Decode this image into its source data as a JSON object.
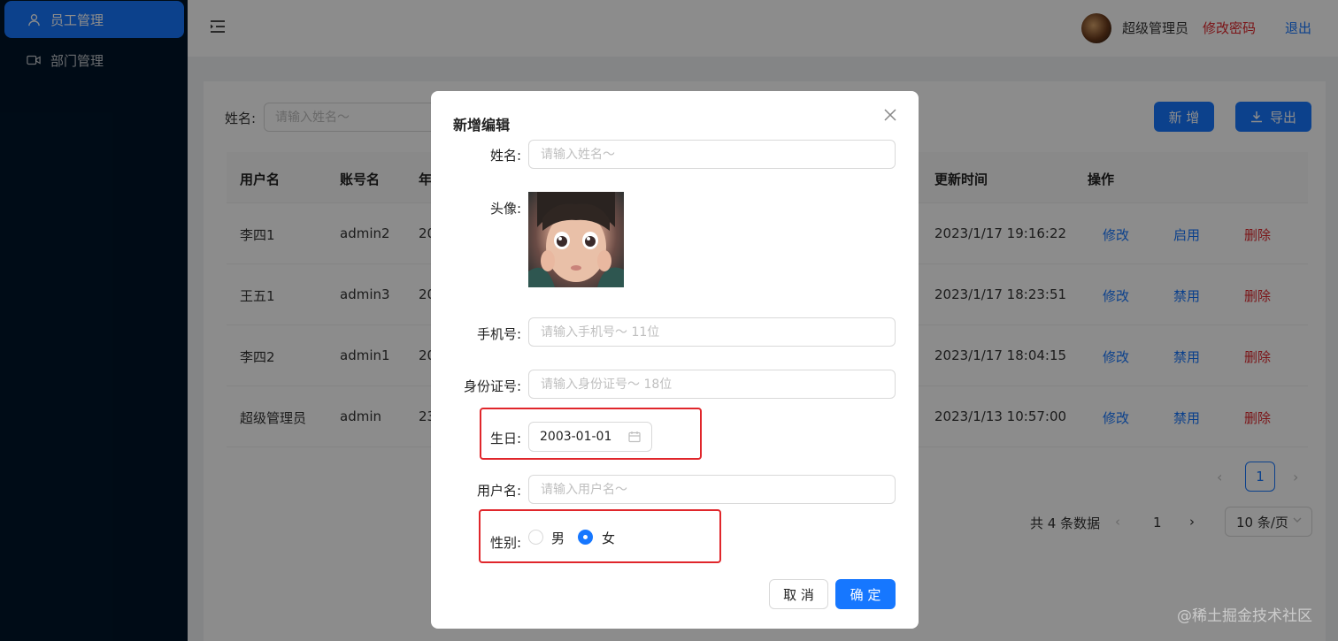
{
  "sidebar": {
    "items": [
      {
        "label": "员工管理",
        "icon": "user-icon",
        "active": true
      },
      {
        "label": "部门管理",
        "icon": "video-icon",
        "active": false
      }
    ]
  },
  "header": {
    "admin_name": "超级管理员",
    "change_password": "修改密码",
    "logout": "退出"
  },
  "search": {
    "label": "姓名:",
    "placeholder": "请输入姓名～"
  },
  "toolbar": {
    "add_label": "新 增",
    "export_label": "导出"
  },
  "table": {
    "headers": [
      "用户名",
      "账号名",
      "年",
      "更新时间",
      "操作"
    ],
    "rows": [
      {
        "name": "李四1",
        "account": "admin2",
        "year": "20",
        "updated": "2023/1/17 19:16:22",
        "edit": "修改",
        "toggle": "启用",
        "delete": "删除"
      },
      {
        "name": "王五1",
        "account": "admin3",
        "year": "20",
        "updated": "2023/1/17 18:23:51",
        "edit": "修改",
        "toggle": "禁用",
        "delete": "删除"
      },
      {
        "name": "李四2",
        "account": "admin1",
        "year": "20",
        "updated": "2023/1/17 18:04:15",
        "edit": "修改",
        "toggle": "禁用",
        "delete": "删除"
      },
      {
        "name": "超级管理员",
        "account": "admin",
        "year": "23",
        "updated": "2023/1/13 10:57:00",
        "edit": "修改",
        "toggle": "禁用",
        "delete": "删除"
      }
    ]
  },
  "pagination": {
    "current_page": "1",
    "total_text": "共 4 条数据",
    "page_number": "1",
    "page_size": "10 条/页"
  },
  "modal": {
    "title": "新增编辑",
    "fields": {
      "name_label": "姓名:",
      "name_placeholder": "请输入姓名～",
      "avatar_label": "头像:",
      "phone_label": "手机号:",
      "phone_placeholder": "请输入手机号～ 11位",
      "id_label": "身份证号:",
      "id_placeholder": "请输入身份证号～ 18位",
      "birthday_label": "生日:",
      "birthday_value": "2003-01-01",
      "username_label": "用户名:",
      "username_placeholder": "请输入用户名～",
      "gender_label": "性别:",
      "gender_options": [
        "男",
        "女"
      ],
      "gender_selected": "女"
    },
    "cancel_label": "取 消",
    "ok_label": "确 定"
  },
  "watermark": "@稀土掘金技术社区",
  "colors": {
    "primary": "#1677ff",
    "danger": "#e0262b",
    "sidebar_bg": "#001529"
  }
}
